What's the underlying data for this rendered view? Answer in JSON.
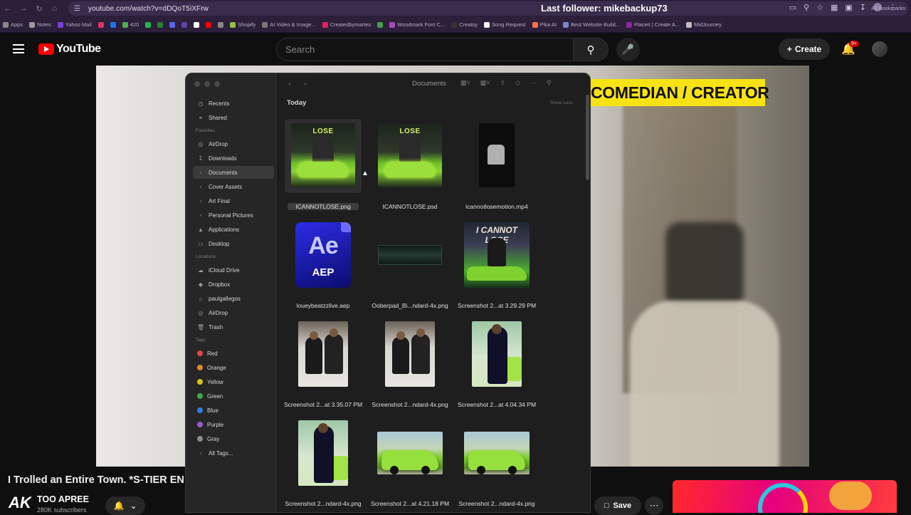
{
  "browser": {
    "url": "youtube.com/watch?v=dDQoT5iXFrw",
    "overlay_text": "Last follower: mikebackup738",
    "bookmarks": [
      {
        "label": "Apps",
        "color": "#888888"
      },
      {
        "label": "Notes",
        "color": "#999999"
      },
      {
        "label": "Yahoo Mail",
        "color": "#7b3fe4"
      },
      {
        "label": "",
        "color": "#e1306c"
      },
      {
        "label": "",
        "color": "#1877f2"
      },
      {
        "label": "420",
        "color": "#4caf50"
      },
      {
        "label": "",
        "color": "#1db954"
      },
      {
        "label": "",
        "color": "#2e7d32"
      },
      {
        "label": "",
        "color": "#5865f2"
      },
      {
        "label": "",
        "color": "#6441a5"
      },
      {
        "label": "",
        "color": "#ffffff"
      },
      {
        "label": "",
        "color": "#ff0000"
      },
      {
        "label": "",
        "color": "#888888"
      },
      {
        "label": "Shopify",
        "color": "#95bf47"
      },
      {
        "label": "AI Video & Image...",
        "color": "#777777"
      },
      {
        "label": "Createdbymartes",
        "color": "#e91e63"
      },
      {
        "label": "",
        "color": "#43a047"
      },
      {
        "label": "Woodmark Font C...",
        "color": "#ab47bc"
      },
      {
        "label": "Creatsy",
        "color": "#333333"
      },
      {
        "label": "Song Request",
        "color": "#f5f5f5"
      },
      {
        "label": "Pika AI",
        "color": "#ff7043"
      },
      {
        "label": "Best Website Build...",
        "color": "#7986cb"
      },
      {
        "label": "Placeit | Create A...",
        "color": "#8e24aa"
      },
      {
        "label": "MidJourney",
        "color": "#bdbdbd"
      }
    ],
    "all_bookmarks": "All Bookmarks"
  },
  "youtube": {
    "brand": "YouTube",
    "search_placeholder": "Search",
    "create_label": "Create",
    "notif_badge": "9+",
    "video_title": "I Trolled an Entire Town. *S-TIER ENDING*",
    "channel": "TOO APREE",
    "subscribers": "280K subscribers",
    "save_label": "Save",
    "video_banner": "COMEDIAN / CREATOR"
  },
  "finder": {
    "title": "Documents",
    "section": "Today",
    "show_less": "Show Less",
    "sidebar": {
      "top": [
        "Recents",
        "Shared"
      ],
      "favorites_head": "Favorites",
      "favorites": [
        "AirDrop",
        "Downloads",
        "Documents",
        "Cover Assets",
        "Art Final",
        "Personal Pictures",
        "Applications",
        "Desktop"
      ],
      "locations_head": "Locations",
      "locations": [
        "iCloud Drive",
        "Dropbox",
        "paulgallegos",
        "AirDrop",
        "Trash"
      ],
      "tags_head": "Tags",
      "tags": [
        {
          "label": "Red",
          "color": "#e04848"
        },
        {
          "label": "Orange",
          "color": "#e08a2c"
        },
        {
          "label": "Yellow",
          "color": "#d9c21f"
        },
        {
          "label": "Green",
          "color": "#3ea84a"
        },
        {
          "label": "Blue",
          "color": "#2f7fe0"
        },
        {
          "label": "Purple",
          "color": "#9b5cc9"
        },
        {
          "label": "Gray",
          "color": "#8c8c8c"
        }
      ],
      "all_tags": "All Tags..."
    },
    "files": [
      "ICANNOTLOSE.png",
      "ICANNOTLOSE.psd",
      "icannotlosemotion.mp4",
      "loueybeatzzlive.aep",
      "Ooberpad_Bi...ndard-4x.png",
      "Screenshot 2...at 3.29.29 PM",
      "Screenshot 2...at 3.35.07 PM",
      "Screenshot 2...ndard-4x.png",
      "Screenshot 2...at 4.04.34 PM",
      "Screenshot 2...ndard-4x.png",
      "Screenshot 2...at 4.21.18 PM",
      "Screenshot 2...ndard-4x.png"
    ],
    "thumb_text": {
      "cover": "LOSE",
      "aep_big": "Ae",
      "aep_small": "AEP",
      "poster": "I CANNOT LOSE"
    }
  }
}
